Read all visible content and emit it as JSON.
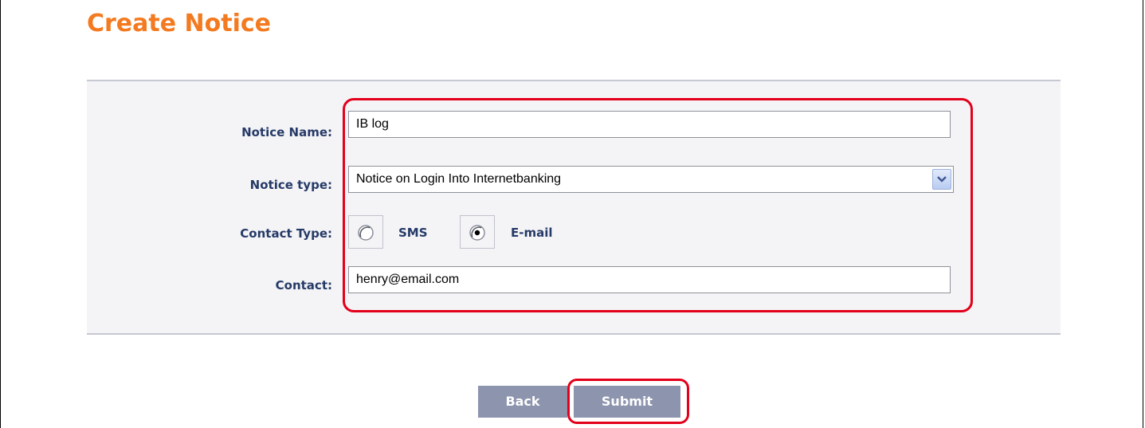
{
  "page": {
    "title": "Create Notice"
  },
  "form": {
    "notice_name": {
      "label": "Notice Name:",
      "value": "IB log"
    },
    "notice_type": {
      "label": "Notice type:",
      "selected": "Notice on Login Into Internetbanking"
    },
    "contact_type": {
      "label": "Contact Type:",
      "options": [
        {
          "label": "SMS",
          "checked": false
        },
        {
          "label": "E-mail",
          "checked": true
        }
      ]
    },
    "contact": {
      "label": "Contact:",
      "value": "henry@email.com"
    }
  },
  "actions": {
    "back_label": "Back",
    "submit_label": "Submit"
  },
  "colors": {
    "title": "#f47a20",
    "label": "#263a67",
    "button": "#8d94ae",
    "highlight": "#e3001b",
    "panel": "#f4f4f7"
  }
}
